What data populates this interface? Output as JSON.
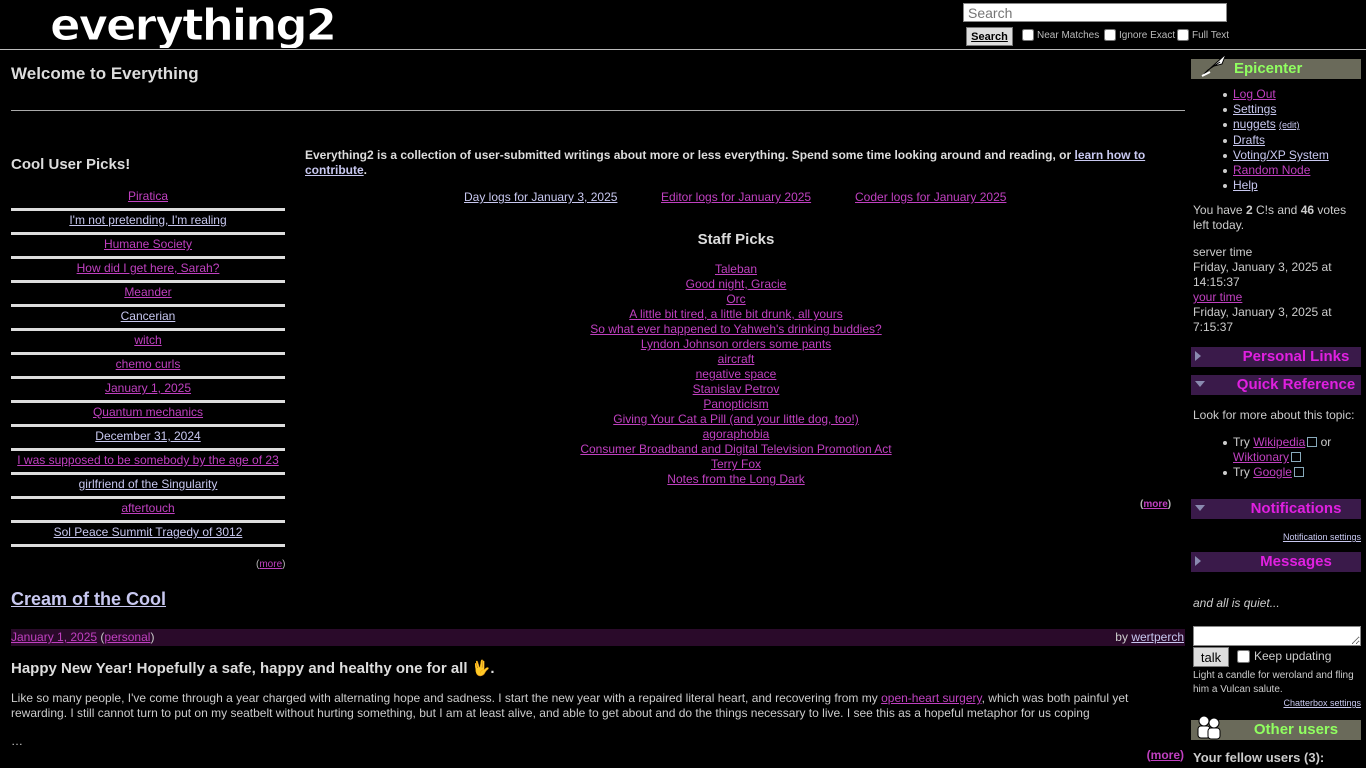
{
  "header": {
    "logo_text": "everything2",
    "search_placeholder": "Search",
    "search_button": "Search",
    "options": [
      "Near Matches",
      "Ignore Exact",
      "Full Text"
    ]
  },
  "main": {
    "title": "Welcome to Everything",
    "cool_title": "Cool User Picks!",
    "cool_picks": [
      "Piratica",
      "I'm not pretending, I'm realing",
      "Humane Society",
      "How did I get here, Sarah?",
      "Meander",
      "Cancerian",
      "witch",
      "chemo curls",
      "January 1, 2025",
      "Quantum mechanics",
      "December 31, 2024",
      "I was supposed to be somebody by the age of 23",
      "girlfriend of the Singularity",
      "aftertouch",
      "Sol Peace Summit Tragedy of 3012"
    ],
    "more_label": "more",
    "intro_text": "Everything2 is a collection of user-submitted writings about more or less everything. Spend some time looking around and reading, or",
    "intro_link": "learn how to contribute",
    "logs": [
      "Day logs for January 3, 2025",
      "Editor logs for January 2025",
      "Coder logs for January 2025"
    ],
    "staff_title": "Staff Picks",
    "staff_picks": [
      "Taleban",
      "Good night, Gracie",
      "Orc",
      "A little bit tired, a little bit drunk, all yours",
      "So what ever happened to Yahweh's drinking buddies?",
      "Lyndon Johnson orders some pants",
      "aircraft",
      "negative space",
      "Stanislav Petrov",
      "Panopticism",
      "Giving Your Cat a Pill (and your little dog, too!)",
      "agoraphobia",
      "Consumer Broadband and Digital Television Promotion Act",
      "Terry Fox",
      "Notes from the Long Dark"
    ],
    "cream": {
      "title": "Cream of the Cool",
      "date": "January 1, 2025",
      "type": "personal",
      "by_label": "by",
      "author": "wertperch",
      "headline": "Happy New Year! Hopefully a safe, happy and healthy one for all 🖖.",
      "body_before": "Like so many people, I've come through a year charged with alternating hope and sadness. I start the new year with a repaired literal heart, and recovering from my",
      "body_link": "open-heart surgery",
      "body_after": ", which was both painful yet rewarding. I still cannot turn to put on my seatbelt without hurting something, but I am at least alive, and able to get about and do the things necessary to live. I see this as a hopeful metaphor for us coping",
      "ellipsis": "…",
      "more": "more"
    }
  },
  "sidebar": {
    "epicenter_title": "Epicenter",
    "epicenter_links": [
      "Log Out",
      "Settings",
      "nuggets",
      "Drafts",
      "Voting/XP System",
      "Random Node",
      "Help"
    ],
    "edit_label": "(edit)",
    "votes_text_1": "You have",
    "cools": "2",
    "votes_text_2": "C!s and",
    "votes": "46",
    "votes_text_3": "votes left today.",
    "server_time_label": "server time",
    "server_time": "Friday, January 3, 2025 at 14:15:37",
    "your_time_label": "your time",
    "your_time": "Friday, January 3, 2025 at 7:15:37",
    "personal_links_title": "Personal Links",
    "quick_ref_title": "Quick Reference",
    "quick_ref_intro": "Look for more about this topic:",
    "try_label": "Try",
    "or_label": "or",
    "wikipedia": "Wikipedia",
    "wiktionary": "Wiktionary",
    "google": "Google",
    "notifications_title": "Notifications",
    "notification_settings": "Notification settings",
    "messages_title": "Messages",
    "quiet_text": "and all is quiet...",
    "talk_button": "talk",
    "keep_updating": "Keep updating",
    "candle_text": "Light a candle for weroland and fling him a Vulcan salute.",
    "chatterbox_settings": "Chatterbox settings",
    "other_users_title": "Other users",
    "fellow_users": "Your fellow users (3):"
  },
  "colors": {
    "background": "#000000",
    "epicenter_title": "#90ff60",
    "nodelet_title": "#e020e0",
    "visited_link": "#c040c0",
    "link": "#c8c8f0"
  }
}
